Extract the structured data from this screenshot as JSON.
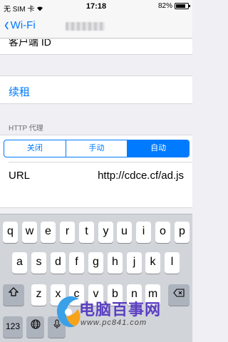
{
  "status_bar": {
    "carrier": "无 SIM 卡",
    "time": "17:18",
    "battery_text": "82%",
    "battery_level": 0.82
  },
  "nav": {
    "back_label": "Wi-Fi"
  },
  "partial_row": {
    "label": "客户端 ID"
  },
  "renew_label": "续租",
  "proxy": {
    "header": "HTTP 代理",
    "options": [
      "关闭",
      "手动",
      "自动"
    ],
    "selected": "自动",
    "url_label": "URL",
    "url_value": "http://cdce.cf/ad.js"
  },
  "keyboard": {
    "row1": [
      "q",
      "w",
      "e",
      "r",
      "t",
      "y",
      "u",
      "i",
      "o",
      "p"
    ],
    "row2": [
      "a",
      "s",
      "d",
      "f",
      "g",
      "h",
      "j",
      "k",
      "l"
    ],
    "row3": [
      "z",
      "x",
      "c",
      "v",
      "b",
      "n",
      "m"
    ],
    "numbers_key": "123"
  },
  "watermark": {
    "brand": "电脑百事网",
    "domain": "www.pc841.com"
  },
  "colors": {
    "accent": "#007aff",
    "brand": "#5b3fc2"
  }
}
